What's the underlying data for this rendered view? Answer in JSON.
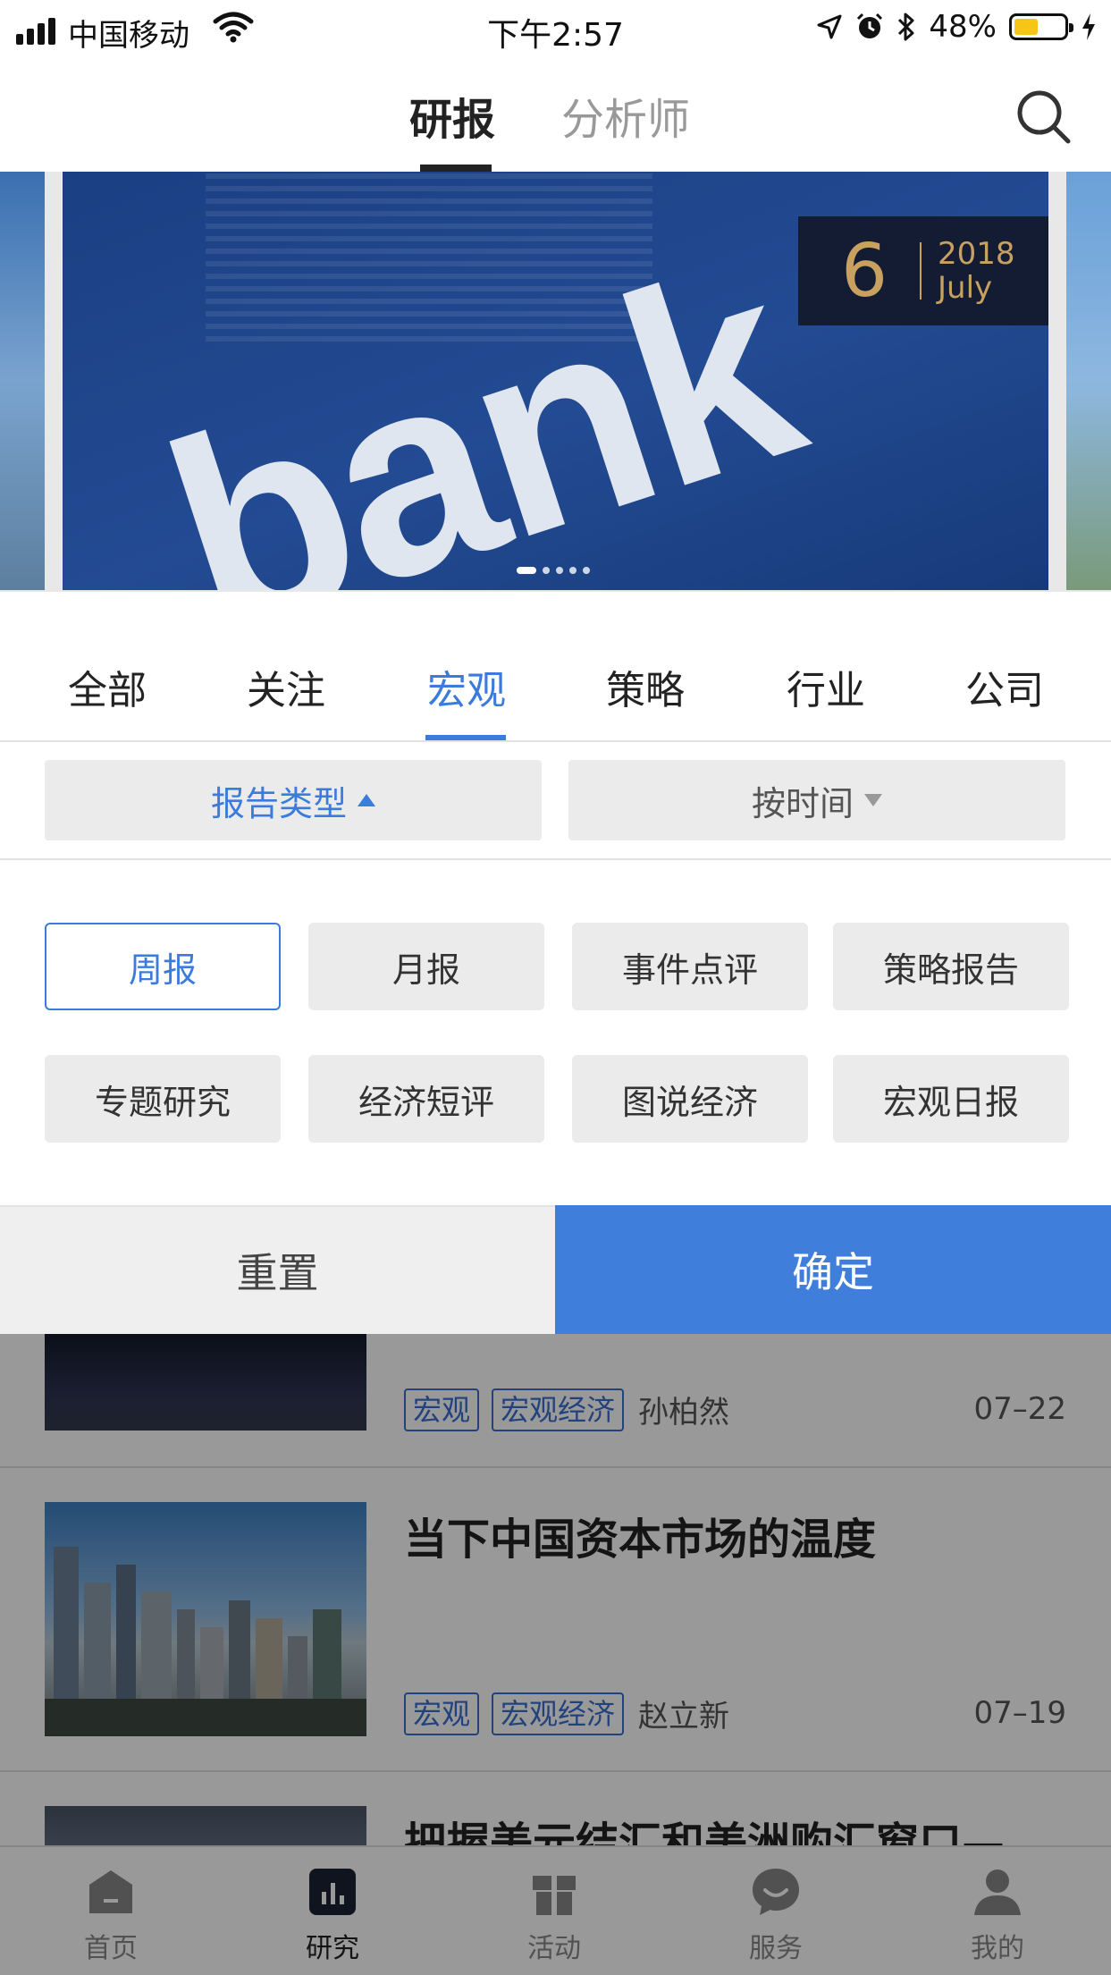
{
  "status_bar": {
    "carrier": "中国移动",
    "time": "下午2:57",
    "battery": "48%",
    "battery_level": 0.48
  },
  "nav": {
    "tabs": [
      {
        "label": "研报"
      },
      {
        "label": "分析师"
      }
    ],
    "active_tab": "研报",
    "search_icon": "search-icon"
  },
  "banner": {
    "image_text": "bank",
    "day": "6",
    "year": "2018",
    "month": "July",
    "slide_count": 5,
    "active_slide": 1
  },
  "categories": [
    {
      "label": "全部"
    },
    {
      "label": "关注"
    },
    {
      "label": "宏观"
    },
    {
      "label": "策略"
    },
    {
      "label": "行业"
    },
    {
      "label": "公司"
    }
  ],
  "active_category": "宏观",
  "filters": {
    "report_type": "报告类型",
    "by_time": "按时间"
  },
  "options": [
    {
      "label": "周报"
    },
    {
      "label": "月报"
    },
    {
      "label": "事件点评"
    },
    {
      "label": "策略报告"
    },
    {
      "label": "专题研究"
    },
    {
      "label": "经济短评"
    },
    {
      "label": "图说经济"
    },
    {
      "label": "宏观日报"
    }
  ],
  "selected_option": "周报",
  "actions": {
    "reset": "重置",
    "confirm": "确定"
  },
  "reports": [
    {
      "title": "",
      "tags": [
        "宏观",
        "宏观经济"
      ],
      "author": "孙柏然",
      "date": "07–22"
    },
    {
      "title": "当下中国资本市场的温度",
      "tags": [
        "宏观",
        "宏观经济"
      ],
      "author": "赵立新",
      "date": "07–19"
    },
    {
      "title": "把握美元结汇和美洲购汇窗口—",
      "tags": [],
      "author": "",
      "date": ""
    }
  ],
  "tabbar": [
    {
      "label": "首页",
      "icon": "home-icon"
    },
    {
      "label": "研究",
      "icon": "chart-icon"
    },
    {
      "label": "活动",
      "icon": "gift-icon"
    },
    {
      "label": "服务",
      "icon": "chat-icon"
    },
    {
      "label": "我的",
      "icon": "user-icon"
    }
  ],
  "colors": {
    "accent": "#3f7fdb",
    "gold": "#c8a060",
    "banner_blue": "#1b3f83"
  }
}
